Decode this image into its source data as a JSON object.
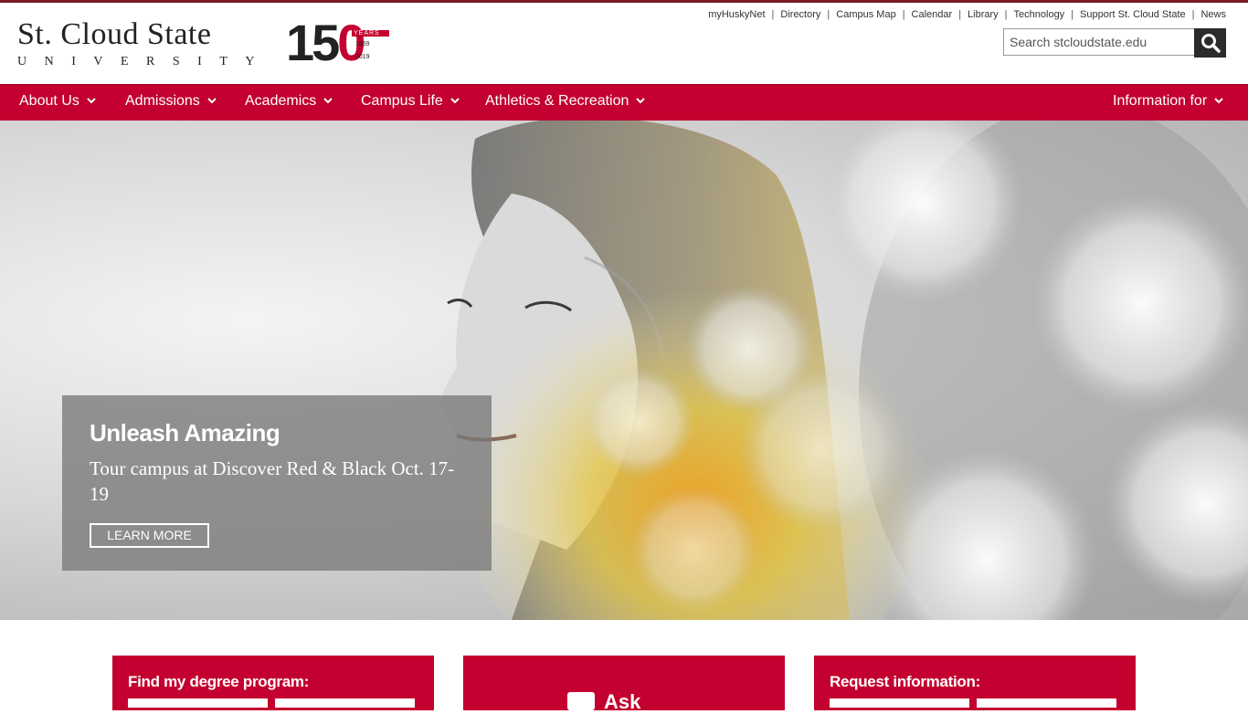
{
  "brand": {
    "name_line1": "St. Cloud State",
    "name_line2": "UNIVERSITY",
    "anniversary_number_prefix": "15",
    "anniversary_number_zero": "0",
    "anniversary_years": "YEARS",
    "anniversary_start": "1869",
    "anniversary_end": "2019",
    "accent_color": "#c3002f"
  },
  "utility_links": [
    "myHuskyNet",
    "Directory",
    "Campus Map",
    "Calendar",
    "Library",
    "Technology",
    "Support St. Cloud State",
    "News"
  ],
  "search": {
    "placeholder": "Search stcloudstate.edu",
    "icon": "search-icon"
  },
  "nav": {
    "items": [
      {
        "label": "About Us"
      },
      {
        "label": "Admissions"
      },
      {
        "label": "Academics"
      },
      {
        "label": "Campus Life"
      },
      {
        "label": "Athletics & Recreation"
      }
    ],
    "right_item": {
      "label": "Information for"
    }
  },
  "hero": {
    "title": "Unleash Amazing",
    "text": "Tour campus at Discover Red & Black Oct. 17-19",
    "button": "LEARN MORE"
  },
  "cards": {
    "degree": {
      "label": "Find my degree program:"
    },
    "ask": {
      "label": "Ask"
    },
    "request": {
      "label": "Request information:"
    }
  }
}
